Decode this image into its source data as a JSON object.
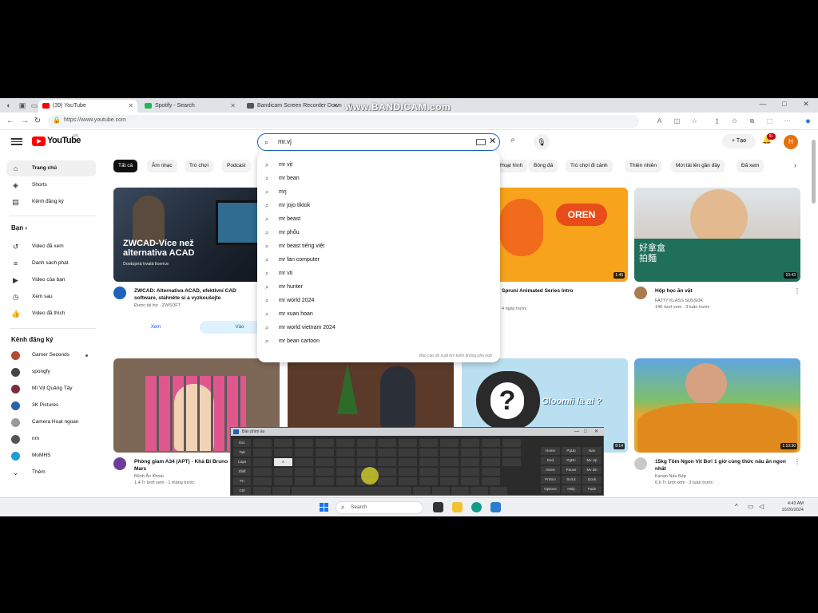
{
  "watermark": "www.BANDICAM.com",
  "browser": {
    "tabs": [
      {
        "label": "(39) YouTube",
        "active": true,
        "color": "#ff0000"
      },
      {
        "label": "Spotify - Search",
        "active": false,
        "color": "#1db954"
      },
      {
        "label": "Bandicam Screen Recorder Down",
        "active": false,
        "color": "#555555"
      }
    ],
    "url": "https://www.youtube.com",
    "window_controls": [
      "—",
      "□",
      "✕"
    ]
  },
  "youtube": {
    "logo": "YouTube",
    "country": "VN",
    "search_query": "mr.vj",
    "create_label": "+ Tạo",
    "notification_count": "9+",
    "avatar_letter": "H",
    "accent": "#ff0000"
  },
  "sidebar": {
    "main": [
      {
        "label": "Trang chủ",
        "icon": "home-icon",
        "glyph": "⌂",
        "active": true
      },
      {
        "label": "Shorts",
        "icon": "shorts-icon",
        "glyph": "◈"
      },
      {
        "label": "Kênh đăng ký",
        "icon": "subscriptions-icon",
        "glyph": "▤"
      }
    ],
    "you_title": "Bạn ›",
    "you": [
      {
        "label": "Video đã xem",
        "icon": "history-icon",
        "glyph": "↺"
      },
      {
        "label": "Danh sách phát",
        "icon": "playlist-icon",
        "glyph": "≡"
      },
      {
        "label": "Video của bạn",
        "icon": "your-videos-icon",
        "glyph": "▶"
      },
      {
        "label": "Xem sau",
        "icon": "watch-later-icon",
        "glyph": "◷"
      },
      {
        "label": "Video đã thích",
        "icon": "like-icon",
        "glyph": "👍"
      }
    ],
    "subs_title": "Kênh đăng ký",
    "subs": [
      {
        "label": "Gamer Seconds",
        "color": "#b5492f"
      },
      {
        "label": "spongfy",
        "color": "#444444"
      },
      {
        "label": "Mì Vịt Quảng Tây",
        "color": "#7a2d3a"
      },
      {
        "label": "3K Pictures",
        "color": "#2c5fb0"
      },
      {
        "label": "Camera Hoạt ngoan",
        "color": "#9a9a9a"
      },
      {
        "label": "nm",
        "color": "#555555"
      },
      {
        "label": "MoMHS",
        "color": "#1c9dd8"
      }
    ],
    "more_label": "Thêm"
  },
  "chips": [
    {
      "label": "Tất cả",
      "active": true
    },
    {
      "label": "Âm nhạc"
    },
    {
      "label": "Trò chơi"
    },
    {
      "label": "Podcast"
    },
    {
      "label": "Hoạt hình"
    },
    {
      "label": "Bóng đá"
    },
    {
      "label": "Trò chơi đi cảnh"
    },
    {
      "label": "Thiên nhiên"
    },
    {
      "label": "Mới tải lên gần đây"
    },
    {
      "label": "Đã xem"
    }
  ],
  "suggestions": {
    "items": [
      "mr vịt",
      "mr bean",
      "mrj",
      "mr jojo tiktok",
      "mr beast",
      "mr phốu",
      "mr beast tiếng việt",
      "mr fan computer",
      "mr vti",
      "mr hunter",
      "mr world 2024",
      "mr xuan hoan",
      "mr world vietnam 2024",
      "mr bean cartoon"
    ],
    "footer": "Báo cáo đề xuất tìm kiếm không phù hợp"
  },
  "videos": [
    {
      "title": "ZWCAD: Alternativa ACAD, efektivní CAD software, stáhněte si a vyzkoušejte",
      "meta1": "Được tài trợ · ZWSOFT",
      "meta2": "",
      "duration": "",
      "thumb_text": "ZWCAD-Více než alternativa ACAD",
      "thumb_sub": "Dostupná trvalá licence",
      "btn1": "Xem",
      "btn2": "Vào"
    },
    {
      "title": "Spruni Animated Series Intro",
      "meta1": "",
      "meta2": "4 ngày trước",
      "duration": "1:46",
      "thumb_text": "OREN"
    },
    {
      "title": "Hộp học ăn vặt",
      "meta1": "FATTY KLASS SUSSOK",
      "meta2": "14K lượt xem · 3 tuần trước",
      "duration": "10:43",
      "thumb_text": "好拿盒 拍麵"
    },
    {
      "title": "Phòng giam A34 (APT) - Khả Bi Bruno Mars",
      "meta1": "Bệnh Ăn Khoai",
      "meta2": "1,4 Tr lượt xem · 1 tháng trước",
      "duration": ""
    },
    {
      "title": "",
      "meta1": "",
      "meta2": "",
      "duration": ""
    },
    {
      "title": "",
      "meta1": "",
      "meta2": "",
      "duration": "8:14",
      "thumb_text": "Gloomii là ai ?"
    },
    {
      "title": "15kg Tôm Ngon Vịt Bơ! 1 giờ cùng thức nấu ăn ngon nhất",
      "meta1": "Kanan Nấu Bếp",
      "meta2": "6,6 Tr lượt xem · 3 tuần trước",
      "duration": "1:10:30"
    }
  ],
  "osk": {
    "title": "Bàn phím ảo",
    "row_labels": [
      "Esc",
      "Tab",
      "Caps",
      "Shift",
      "Fn",
      "Ctrl"
    ],
    "nav_keys": [
      "Home",
      "PgUp",
      "Nav",
      "End",
      "PgDn",
      "Mv Up",
      "Insert",
      "Pause",
      "Mv Dn",
      "PrtScn",
      "ScrLk",
      "Dock",
      "Options",
      "Help",
      "Fade"
    ],
    "highlight_key": "A"
  },
  "taskbar": {
    "search_label": "Search",
    "time": "4:43 AM",
    "date": "10/20/2024"
  }
}
